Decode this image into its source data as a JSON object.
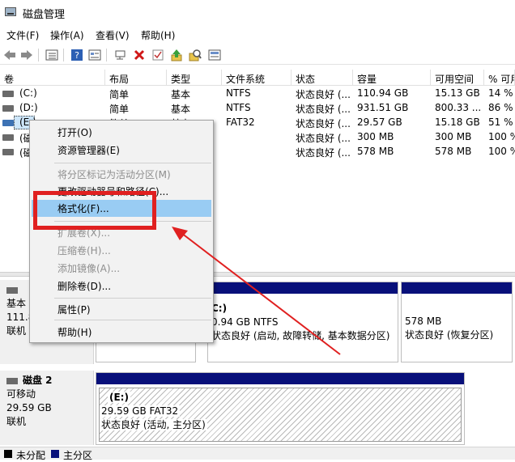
{
  "window": {
    "title": "磁盘管理"
  },
  "menu": {
    "items": [
      "文件(F)",
      "操作(A)",
      "查看(V)",
      "帮助(H)"
    ]
  },
  "toolbar": {
    "icons": [
      "back-arrow-icon",
      "forward-arrow-icon",
      "list-view-icon",
      "help-icon",
      "properties-icon",
      "connect-icon",
      "delete-icon",
      "check-icon",
      "upload-icon",
      "search-icon",
      "wizard-icon"
    ]
  },
  "volume_list": {
    "headers": [
      "卷",
      "布局",
      "类型",
      "文件系统",
      "状态",
      "容量",
      "可用空间",
      "% 可用"
    ],
    "rows": [
      {
        "vol": "(C:)",
        "layout": "简单",
        "type": "基本",
        "fs": "NTFS",
        "status": "状态良好 (...",
        "capacity": "110.94 GB",
        "free": "15.13 GB",
        "pct": "14 %"
      },
      {
        "vol": "(D:)",
        "layout": "简单",
        "type": "基本",
        "fs": "NTFS",
        "status": "状态良好 (...",
        "capacity": "931.51 GB",
        "free": "800.33 ...",
        "pct": "86 %"
      },
      {
        "vol": "(E:)",
        "layout": "简单",
        "type": "基本",
        "fs": "FAT32",
        "status": "状态良好 (...",
        "capacity": "29.57 GB",
        "free": "15.18 GB",
        "pct": "51 %"
      },
      {
        "vol": "(磁",
        "layout": "",
        "type": "",
        "fs": "",
        "status": "状态良好 (...",
        "capacity": "300 MB",
        "free": "300 MB",
        "pct": "100 %"
      },
      {
        "vol": "(磁",
        "layout": "",
        "type": "",
        "fs": "",
        "status": "状态良好 (...",
        "capacity": "578 MB",
        "free": "578 MB",
        "pct": "100 %"
      }
    ]
  },
  "disks": {
    "disk1": {
      "label_lines": [
        "基本",
        "111.8",
        "联机"
      ],
      "part_c_label": "C:)",
      "part_c_size": "0.94 GB NTFS",
      "part_c_status": "状态良好 (启动, 故障转储, 基本数据分区)",
      "part_r_size": "578 MB",
      "part_r_status": "状态良好 (恢复分区)"
    },
    "disk2": {
      "name": "磁盘 2",
      "type": "可移动",
      "size": "29.59 GB",
      "state": "联机",
      "part_label": "(E:)",
      "part_size": "29.59 GB FAT32",
      "part_status": "状态良好 (活动, 主分区)"
    }
  },
  "legend": {
    "unallocated": "未分配",
    "primary": "主分区",
    "unallocated_color": "#000000",
    "primary_color": "#08107a"
  },
  "context_menu": {
    "open": "打开(O)",
    "explorer": "资源管理器(E)",
    "mark_active": "将分区标记为活动分区(M)",
    "change_letter": "更改驱动器号和路径(C)...",
    "format": "格式化(F)...",
    "extend": "扩展卷(X)...",
    "shrink": "压缩卷(H)...",
    "mirror": "添加镜像(A)...",
    "delete": "删除卷(D)...",
    "properties": "属性(P)",
    "help": "帮助(H)"
  },
  "colors": {
    "partition_bar": "#08107a",
    "menu_highlight": "#99ccf3",
    "annotation": "#e02020"
  }
}
